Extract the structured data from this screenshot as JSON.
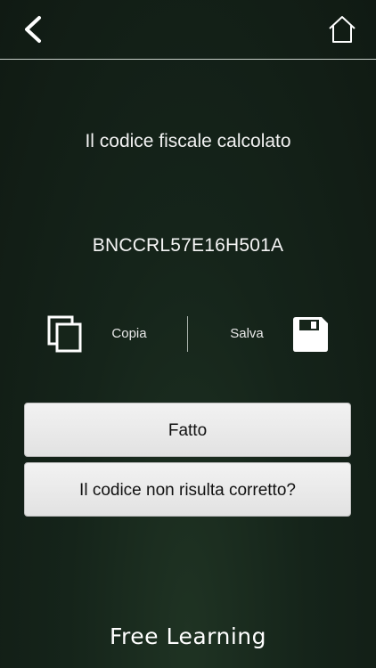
{
  "header": {
    "back_icon": "back-chevron-icon",
    "home_icon": "home-icon"
  },
  "result": {
    "title": "Il codice fiscale calcolato",
    "code": "BNCCRL57E16H501A"
  },
  "actions": {
    "copy_label": "Copia",
    "copy_icon": "copy-icon",
    "save_label": "Salva",
    "save_icon": "save-icon"
  },
  "buttons": {
    "done": "Fatto",
    "not_correct": "Il codice non risulta corretto?"
  },
  "footer": {
    "brand": "Free Learning"
  },
  "colors": {
    "background": "#15241a",
    "text": "#ffffff",
    "button_bg": "#eeeeee",
    "button_text": "#111111"
  }
}
